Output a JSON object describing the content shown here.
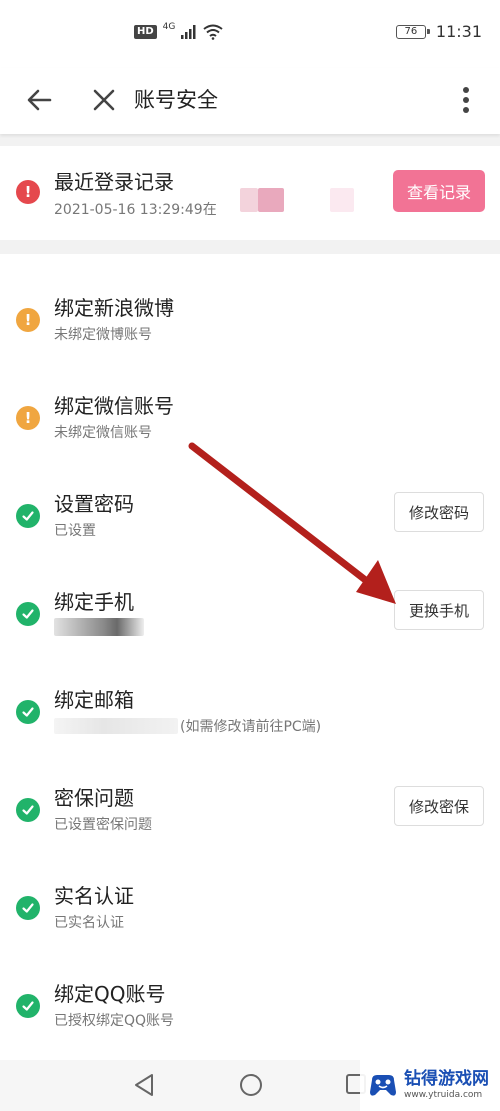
{
  "status_bar": {
    "hd": "HD",
    "network": "4G",
    "battery": "76",
    "time": "11:31"
  },
  "header": {
    "title": "账号安全",
    "back_icon": "arrow-left-icon",
    "close_icon": "close-icon",
    "more_icon": "more-vertical-icon"
  },
  "login_record": {
    "title": "最近登录记录",
    "detail": "2021-05-16 13:29:49在",
    "button": "查看记录",
    "status": "danger"
  },
  "items": [
    {
      "title": "绑定新浪微博",
      "subtitle": "未绑定微博账号",
      "status": "warning"
    },
    {
      "title": "绑定微信账号",
      "subtitle": "未绑定微信账号",
      "status": "warning"
    },
    {
      "title": "设置密码",
      "subtitle": "已设置",
      "status": "ok",
      "button": "修改密码"
    },
    {
      "title": "绑定手机",
      "subtitle": "",
      "status": "ok",
      "button": "更换手机"
    },
    {
      "title": "绑定邮箱",
      "subtitle": "(如需修改请前往PC端)",
      "status": "ok"
    },
    {
      "title": "密保问题",
      "subtitle": "已设置密保问题",
      "status": "ok",
      "button": "修改密保"
    },
    {
      "title": "实名认证",
      "subtitle": "已实名认证",
      "status": "ok"
    },
    {
      "title": "绑定QQ账号",
      "subtitle": "已授权绑定QQ账号",
      "status": "ok"
    }
  ],
  "colors": {
    "danger": "#e5484d",
    "warning": "#f0a640",
    "ok": "#21b36a",
    "accent": "#f27395",
    "annotation_arrow": "#b3201c"
  },
  "watermark": {
    "name": "钻得游戏网",
    "url": "www.ytruida.com"
  }
}
